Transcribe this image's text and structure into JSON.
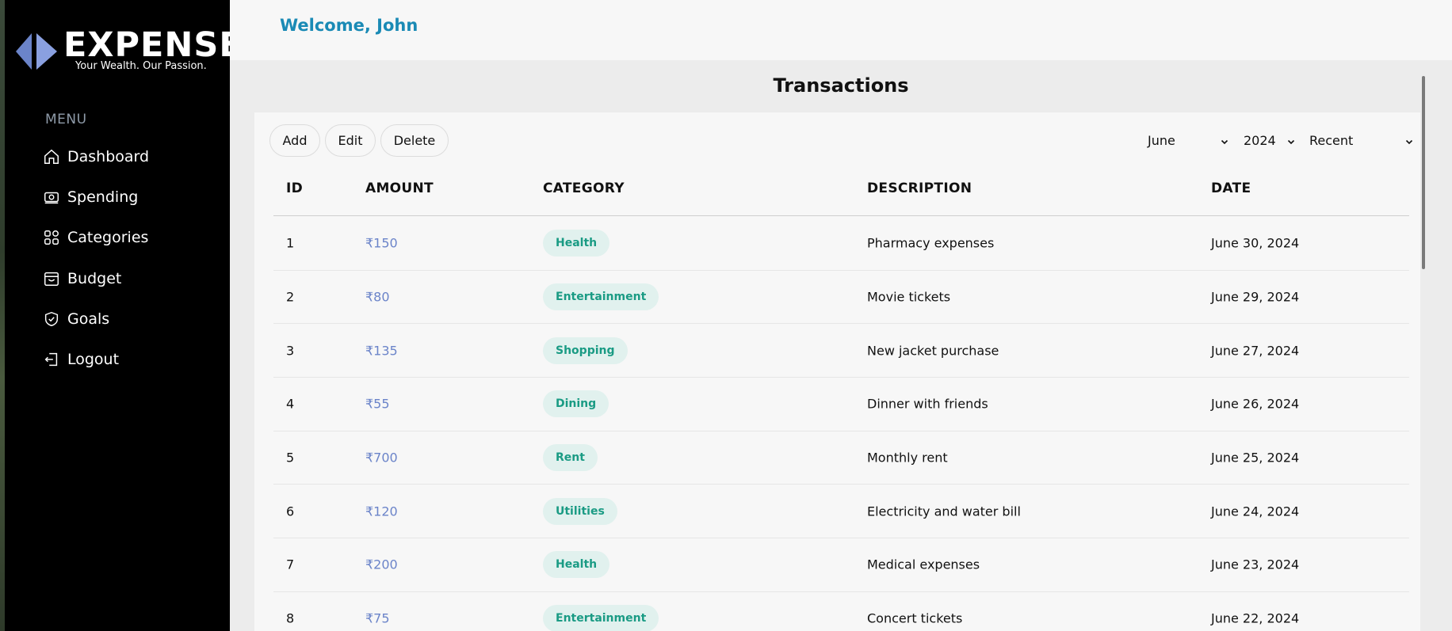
{
  "brand": {
    "name": "EXPENSE",
    "tagline": "Your Wealth. Our Passion.",
    "accent": "#6b84c9"
  },
  "sidebar": {
    "menu_heading": "MENU",
    "items": [
      {
        "label": "Dashboard",
        "icon": "home-icon"
      },
      {
        "label": "Spending",
        "icon": "money-icon"
      },
      {
        "label": "Categories",
        "icon": "grid-icon"
      },
      {
        "label": "Budget",
        "icon": "wallet-icon"
      },
      {
        "label": "Goals",
        "icon": "shield-check-icon"
      },
      {
        "label": "Logout",
        "icon": "logout-icon"
      }
    ]
  },
  "header": {
    "welcome": "Welcome, John",
    "welcome_color": "#1a8ab5"
  },
  "main": {
    "title": "Transactions",
    "toolbar": {
      "add_label": "Add",
      "edit_label": "Edit",
      "delete_label": "Delete"
    },
    "filters": {
      "month": "June",
      "year": "2024",
      "sort": "Recent"
    },
    "columns": {
      "id": "ID",
      "amount": "AMOUNT",
      "category": "CATEGORY",
      "description": "DESCRIPTION",
      "date": "DATE"
    },
    "rows": [
      {
        "id": "1",
        "amount": "₹150",
        "category": "Health",
        "description": "Pharmacy expenses",
        "date": "June 30, 2024"
      },
      {
        "id": "2",
        "amount": "₹80",
        "category": "Entertainment",
        "description": "Movie tickets",
        "date": "June 29, 2024"
      },
      {
        "id": "3",
        "amount": "₹135",
        "category": "Shopping",
        "description": "New jacket purchase",
        "date": "June 27, 2024"
      },
      {
        "id": "4",
        "amount": "₹55",
        "category": "Dining",
        "description": "Dinner with friends",
        "date": "June 26, 2024"
      },
      {
        "id": "5",
        "amount": "₹700",
        "category": "Rent",
        "description": "Monthly rent",
        "date": "June 25, 2024"
      },
      {
        "id": "6",
        "amount": "₹120",
        "category": "Utilities",
        "description": "Electricity and water bill",
        "date": "June 24, 2024"
      },
      {
        "id": "7",
        "amount": "₹200",
        "category": "Health",
        "description": "Medical expenses",
        "date": "June 23, 2024"
      },
      {
        "id": "8",
        "amount": "₹75",
        "category": "Entertainment",
        "description": "Concert tickets",
        "date": "June 22, 2024"
      }
    ],
    "badge_bg": "#e1f1ee",
    "badge_text": "#1a9b84"
  }
}
